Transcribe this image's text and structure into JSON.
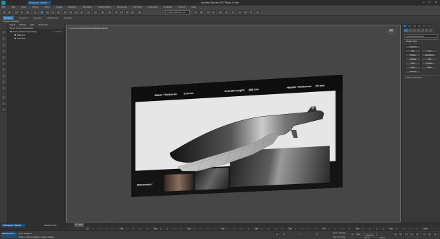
{
  "titlebar": {
    "workspace": "Workspace: Default",
    "title": "Autodesk 3ds Max 2017    Blade_00.max"
  },
  "menubar": [
    "File",
    "Edit",
    "Tools",
    "Group",
    "Views",
    "Create",
    "Modifiers",
    "Animation",
    "Graph Editors",
    "Rendering",
    "Civil View",
    "Customize",
    "Scripting",
    "Content",
    "Help"
  ],
  "toolbar": {
    "selection_set": "Create Selection Se"
  },
  "ribbon": {
    "tabs": [
      "Modeling",
      "Freeform",
      "Selection",
      "Object Paint",
      "Populate"
    ],
    "subtitle": "Polygon Modeling"
  },
  "explorer": {
    "tabs": [
      "Select",
      "Display",
      "Edit",
      "Customize"
    ],
    "header": "Name (Sorted Ascending)",
    "frozen": "▲ Frozen",
    "rows": [
      "Name (Sorted Ascending)",
      "Blade01",
      "Plane001"
    ]
  },
  "viewport": {
    "label": "[+] [Perspective] [Standard] [Edged Faces]"
  },
  "board": {
    "blade_thickness": "Blade Thickness:",
    "blade_thickness_val": "6.3 mm",
    "overall_length": "Overall Length:",
    "overall_length_val": "485 mm",
    "handle_thickness": "Handle Thickness:",
    "handle_thickness_val": "25 mm",
    "references": "References:"
  },
  "cmdpanel": {
    "category": "Standard Primitives",
    "object_type": "- Object Type",
    "autogrid": "AutoGrid",
    "buttons": [
      "Box",
      "Cone",
      "Sphere",
      "GeoSphere",
      "Cylinder",
      "Tube",
      "Torus",
      "Pyramid",
      "Teapot",
      "Plane",
      "TextPlus"
    ],
    "name_color": "+ Name and Color"
  },
  "timeline": {
    "frame": "0 / 100",
    "ticks": [
      "0",
      "10",
      "20",
      "30",
      "40",
      "50",
      "60",
      "70",
      "80",
      "90",
      "100"
    ]
  },
  "status": {
    "workspace": "Workspace: Default",
    "selection_set": "Selection Set:",
    "maxscript": "MAXScript Mi",
    "msg1": "None Selected",
    "msg2": "Click or click-and-drag to select objects",
    "x_label": "X:",
    "y_label": "Y:",
    "z_label": "Z:",
    "grid": "Grid = 10.0cm",
    "add_time_tag": "Add Time Tag",
    "auto": "Auto",
    "set_key": "Set K.",
    "selected": "Selected",
    "filters": "Filters..."
  }
}
